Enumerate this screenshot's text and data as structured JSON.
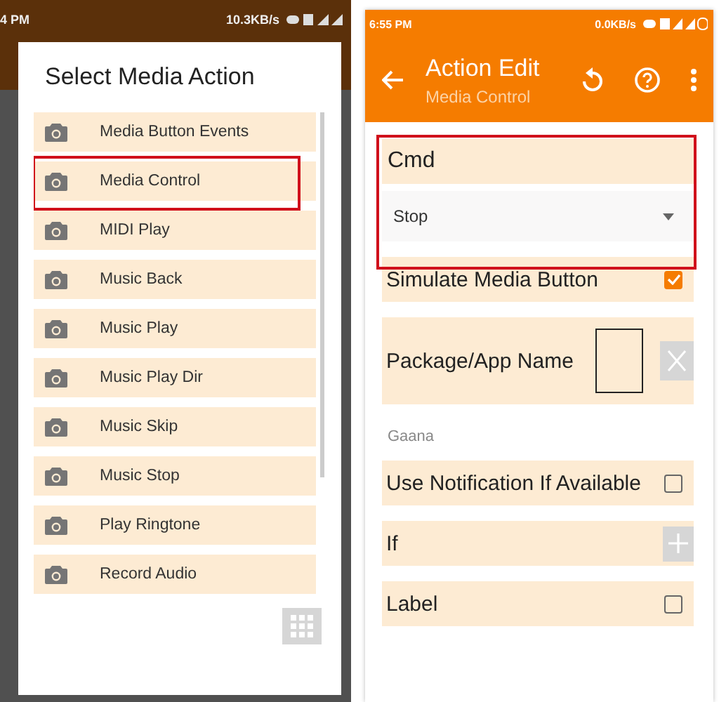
{
  "left_screen": {
    "status_bar": {
      "time": "4 PM",
      "speed": "10.3KB/s"
    },
    "dialog": {
      "title": "Select Media Action",
      "items": [
        {
          "label": "Media Button Events",
          "highlighted": false
        },
        {
          "label": "Media Control",
          "highlighted": true
        },
        {
          "label": "MIDI Play",
          "highlighted": false
        },
        {
          "label": "Music Back",
          "highlighted": false
        },
        {
          "label": "Music Play",
          "highlighted": false
        },
        {
          "label": "Music Play Dir",
          "highlighted": false
        },
        {
          "label": "Music Skip",
          "highlighted": false
        },
        {
          "label": "Music Stop",
          "highlighted": false
        },
        {
          "label": "Play Ringtone",
          "highlighted": false
        },
        {
          "label": "Record Audio",
          "highlighted": false
        }
      ]
    }
  },
  "right_screen": {
    "status_bar": {
      "time": "6:55 PM",
      "speed": "0.0KB/s"
    },
    "toolbar": {
      "title": "Action Edit",
      "subtitle": "Media Control"
    },
    "cmd": {
      "label": "Cmd",
      "value": "Stop",
      "highlighted": true
    },
    "fields": [
      {
        "kind": "checkbox",
        "label": "Simulate Media Button",
        "checked": true
      },
      {
        "kind": "app",
        "label": "Package/App Name"
      },
      {
        "kind": "note",
        "label": "Gaana"
      },
      {
        "kind": "checkbox",
        "label": "Use Notification If Available",
        "checked": false
      },
      {
        "kind": "plus",
        "label": "If"
      },
      {
        "kind": "checkbox",
        "label": "Label",
        "checked": false
      }
    ]
  }
}
